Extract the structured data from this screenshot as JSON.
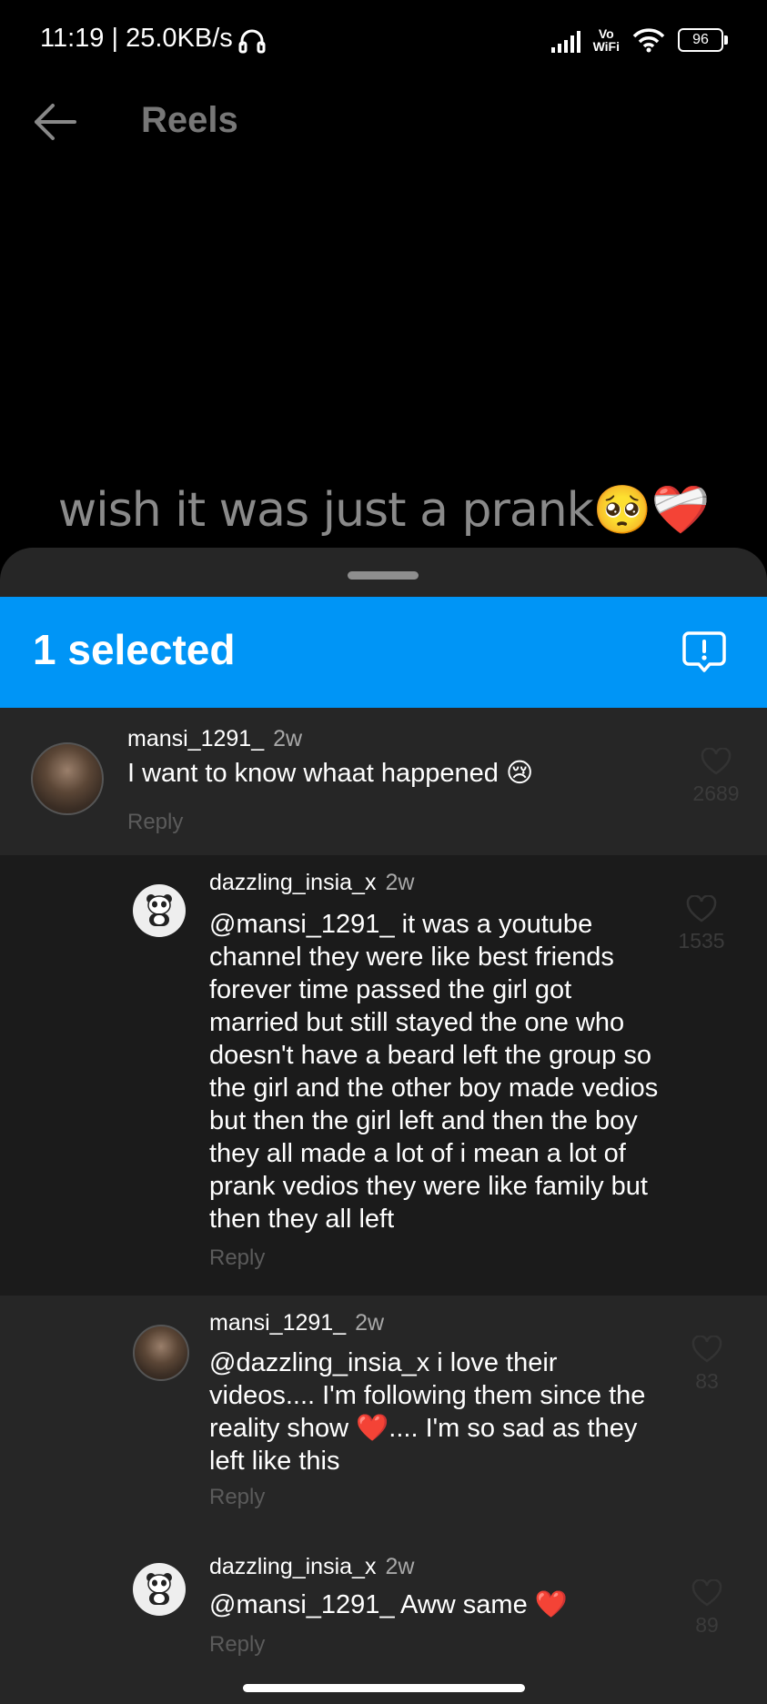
{
  "status_bar": {
    "time": "11:19 | 25.0KB/s",
    "vowifi_top": "Vo",
    "vowifi_bottom": "WiFi",
    "battery": "96"
  },
  "header": {
    "title": "Reels"
  },
  "video": {
    "caption": "wish it was just a prank🥺❤️‍🩹"
  },
  "selection_bar": {
    "count_label": "1 selected"
  },
  "comments": [
    {
      "username": "mansi_1291_",
      "time": "2w",
      "text": "I want to know whaat happened 😢",
      "reply_label": "Reply",
      "likes": "2689"
    },
    {
      "username": "dazzling_insia_x",
      "time": "2w",
      "text": "@mansi_1291_  it was a youtube channel they were like best friends forever time passed the girl got married but still stayed the one who doesn't have a beard left the group so the girl and the other boy made vedios but then the girl left and then the boy they all made a lot of i mean a lot of prank vedios they were like family but then they all left",
      "reply_label": "Reply",
      "likes": "1535"
    },
    {
      "username": "mansi_1291_",
      "time": "2w",
      "text": "@dazzling_insia_x i love their videos.... I'm following them since the reality show ❤️.... I'm so sad as they left like this",
      "reply_label": "Reply",
      "likes": "83"
    },
    {
      "username": "dazzling_insia_x",
      "time": "2w",
      "text": "@mansi_1291_  Aww same ❤️",
      "reply_label": "Reply",
      "likes": "89"
    }
  ]
}
